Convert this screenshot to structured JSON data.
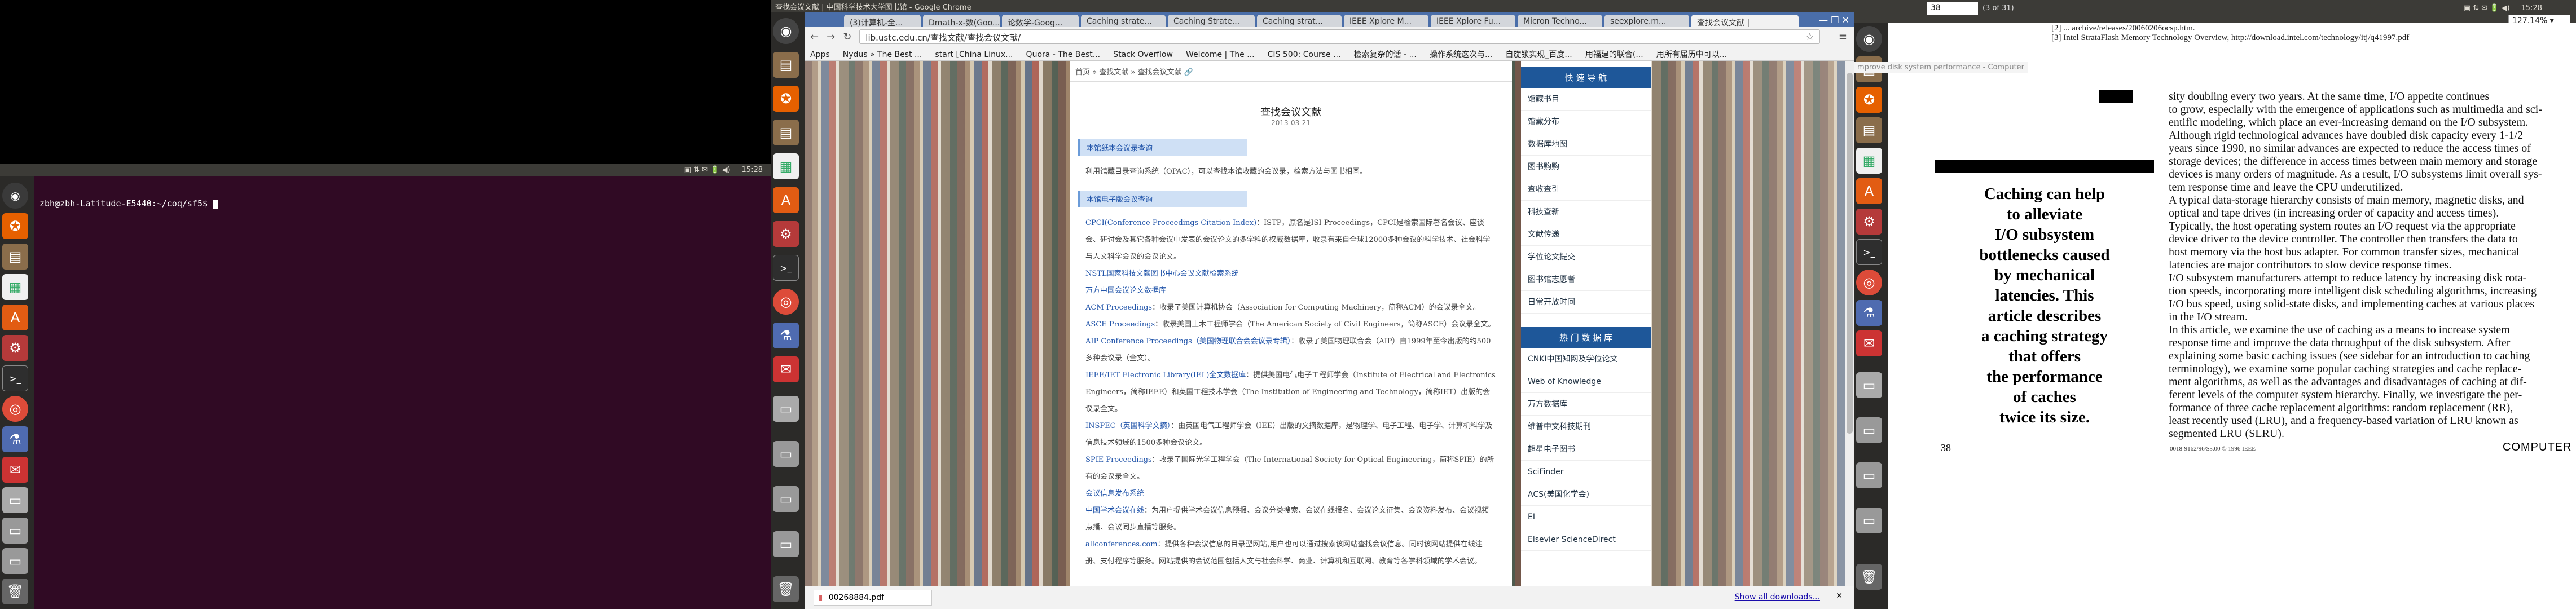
{
  "monitor1": {
    "panel": {
      "time": "15:28"
    },
    "terminal": {
      "title": "zbh@zbh-Latitude-E5440: ~/coq/sf5",
      "prompt": "zbh@zbh-Latitude-E5440:~/coq/sf5$"
    },
    "launcher": [
      "ubuntu-icon",
      "firefox-icon",
      "files-icon",
      "libreoffice-icon",
      "font-icon",
      "settings-icon",
      "terminal-icon",
      "chrome-icon",
      "flask-icon",
      "email-icon",
      "drive-icon",
      "disk-icon",
      "disk-icon",
      "disk-icon",
      "disk-icon",
      "trash-icon"
    ]
  },
  "monitor2": {
    "window_title": "查找会议文献 | 中国科学技术大学图书馆 - Google Chrome",
    "tabs": [
      "(3)计算机-全...",
      "Dmath-x-数(Goo...",
      "论数学-Goog...",
      "Caching strate...",
      "Caching Strate...",
      "Caching strat...",
      "IEEE Xplore M...",
      "IEEE Xplore Fu...",
      "Micron Techno...",
      "seexplore.m...",
      "查找会议文献 |"
    ],
    "url": "lib.ustc.edu.cn/查找文献/查找会议文献/",
    "bookmarks": [
      "Apps",
      "Nydus » The Best ...",
      "start [China Linux...",
      "Quora - The Best...",
      "Stack Overflow",
      "Welcome | The ...",
      "CIS 500: Course ...",
      "检索复杂的话 - ...",
      "操作系统这次与...",
      "自旋锁实现_百度...",
      "用福建的联合(...",
      "用所有届历中可以..."
    ],
    "breadcrumb": [
      "首页",
      "查找文献",
      "查找会议文献"
    ],
    "page": {
      "title": "查找会议文献",
      "date": "2013-03-21",
      "section1_heading": "本馆纸本会议录查询",
      "section1_text": "利用馆藏目录查询系统（OPAC），可以查找本馆收藏的会议录，检索方法与图书相同。",
      "section2_heading": "本馆电子版会议查询",
      "entries": [
        {
          "link": "CPCI(Conference Proceedings Citation Index)",
          "text": "：ISTP，原名是ISI Proceedings，CPCI是检索国际著名会议、座谈会、研讨会及其它各种会议中发表的会议论文的多学科的权威数据库，收录有来自全球12000多种会议的科学技术、社会科学与人文科学会议的会议论文。"
        },
        {
          "link": "NSTL国家科技文献图书中心会议文献检索系统",
          "text": ""
        },
        {
          "link": "万方中国会议论文数据库",
          "text": ""
        },
        {
          "link": "ACM Proceedings",
          "text": "：收录了美国计算机协会（Association for Computing Machinery，简称ACM）的会议录全文。"
        },
        {
          "link": "ASCE Proceedings",
          "text": "：收录美国土木工程师学会（The American Society of Civil Engineers，简称ASCE）会议录全文。"
        },
        {
          "link": "AIP Conference Proceedings（美国物理联合会会议录专辑）",
          "text": "：收录了美国物理联合会（AIP）自1999年至今出版的约500多种会议录（全文）。"
        },
        {
          "link": "IEEE/IET Electronic Library(IEL)全文数据库",
          "text": "：提供美国电气电子工程师学会（Institute of Electrical and Electronics Engineers，简称IEEE）和英国工程技术学会（The Institution of Engineering and Technology，简称IET）出版的会议录全文。"
        },
        {
          "link": "INSPEC（英国科学文摘）",
          "text": "：由英国电气工程师学会（IEE）出版的文摘数据库，是物理学、电子工程、电子学、计算机科学及信息技术领域的1500多种会议论文。"
        },
        {
          "link": "SPIE Proceedings",
          "text": "：收录了国际光学工程学会（The International Society for Optical Engineering，简称SPIE）的所有的会议录全文。"
        },
        {
          "link": "会议信息发布系统",
          "text": ""
        },
        {
          "link": "中国学术会议在线",
          "text": "：为用户提供学术会议信息预报、会议分类搜索、会议在线报名、会议论文征集、会议资料发布、会议视频点播、会议同步直播等服务。"
        },
        {
          "link": "allconferences.com",
          "text": "：提供各种会议信息的目录型网站,用户也可以通过搜索该网站查找会议信息。同时该网站提供在线注册、支付程序等服务。网站提供的会议范围包括人文与社会科学、商业、计算机和互联网、教育等各学科领域的学术会议。"
        }
      ],
      "quick_nav_heading": "快 速 导 航",
      "quick_nav": [
        "馆藏书目",
        "馆藏分布",
        "数据库地图",
        "图书购购",
        "查收查引",
        "科技查新",
        "文献传递",
        "学位论文提交",
        "图书馆志愿者",
        "日常开放时间"
      ],
      "db_heading": "热 门 数 据 库",
      "databases": [
        "CNKI中国知网及学位论文",
        "Web of Knowledge",
        "万方数据库",
        "维普中文科技期刊",
        "超星电子图书",
        "SciFinder",
        "ACS(美国化学会)",
        "EI",
        "Elsevier ScienceDirect"
      ]
    },
    "download": {
      "file": "00268884.pdf",
      "show_all": "Show all downloads..."
    }
  },
  "monitor3": {
    "page_input": "38",
    "page_total": "(3 of 31)",
    "zoom": "127.14%",
    "time": "15:28",
    "header_lines": [
      "[2] ... archive/releases/20060206ocsp.htm.",
      "[3] Intel StrataFlash Memory Technology Overview, http://download.intel.com/technology/itj/q41997.pdf"
    ],
    "side_title": "mprove disk system performance - Computer",
    "pullquote": [
      "Caching can help",
      "to alleviate",
      "I/O subsystem",
      "bottlenecks caused",
      "by mechanical",
      "latencies. This",
      "article describes",
      "a caching strategy",
      "that offers",
      "the performance",
      "of caches",
      "twice its size."
    ],
    "body_lines": [
      "sity doubling every two years. At the same time, I/O appetite continues",
      "to grow, especially with the emergence of applications such as multimedia and sci-",
      "entific modeling, which place an ever-increasing demand on the I/O subsystem.",
      "Although rigid technological advances have doubled disk capacity every 1-1/2",
      "years since 1990, no similar advances are expected to reduce the access times of",
      "storage devices; the difference in access times between main memory and storage",
      "devices is many orders of magnitude. As a result, I/O subsystems limit overall sys-",
      "tem response time and leave the CPU underutilized.",
      "A typical data-storage hierarchy consists of main memory, magnetic disks, and",
      "optical and tape drives (in increasing order of capacity and access times).",
      "Typically, the host operating system routes an I/O request via the appropriate",
      "device driver to the device controller. The controller then transfers the data to",
      "host memory via the host bus adapter. For common transfer sizes, mechanical",
      "latencies are major contributors to slow device response times.",
      "I/O subsystem manufacturers attempt to reduce latency by increasing disk rota-",
      "tion speeds, incorporating more intelligent disk scheduling algorithms, increasing",
      "I/O bus speed, using solid-state disks, and implementing caches at various places",
      "in the I/O stream.",
      "In this article, we examine the use of caching as a means to increase system",
      "response time and improve the data throughput of the disk subsystem. After",
      "explaining some basic caching issues (see sidebar for an introduction to caching",
      "terminology), we examine some popular caching strategies and cache replace-",
      "ment algorithms, as well as the advantages and disadvantages of caching at dif-",
      "ferent levels of the computer system hierarchy. Finally, we investigate the per-",
      "formance of three cache replacement algorithms: random replacement (RR),",
      "least recently used (LRU), and a frequency-based variation of LRU known as",
      "segmented LRU (SLRU)."
    ],
    "footer_page": "38",
    "footer_code": "0018-9162/96/$5.00 © 1996 IEEE",
    "footer_journal": "COMPUTER"
  }
}
